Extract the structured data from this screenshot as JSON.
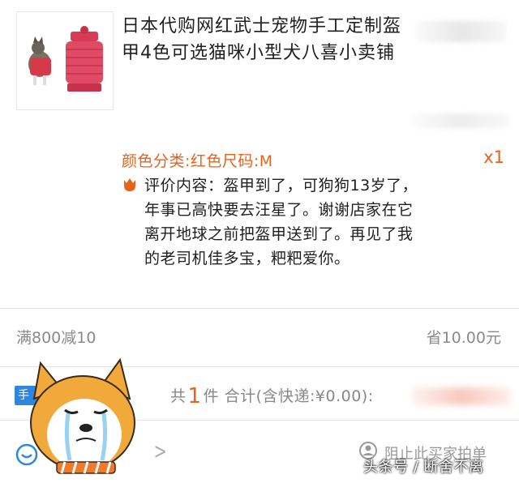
{
  "product": {
    "title": "日本代购网红武士宠物手工定制盔甲4色可选猫咪小型犬八喜小卖铺",
    "sku": "颜色分类:红色尺码:M",
    "quantity": "x1"
  },
  "review": {
    "text": "评价内容：盔甲到了，可狗狗13岁了，年事已高快要去汪星了。谢谢店家在它离开地球之前把盔甲送到了。再见了我的老司机佳多宝，粑粑爱你。"
  },
  "promo": {
    "label": "满800减10",
    "savings": "省10.00元"
  },
  "summary": {
    "tag": "手",
    "prefix": "共",
    "count": "1",
    "suffix": "件  合计(含快递:¥0.00):"
  },
  "footer": {
    "block_label": "阻止此买家拍单",
    "watermark": "头条号 / 断舍不离"
  },
  "colors": {
    "accent": "#e8631a",
    "muted": "#8a8a8a",
    "tag_blue": "#2e86de"
  },
  "icons": [
    "tulip-icon",
    "chevron-right-icon",
    "message-icon",
    "block-user-icon"
  ]
}
